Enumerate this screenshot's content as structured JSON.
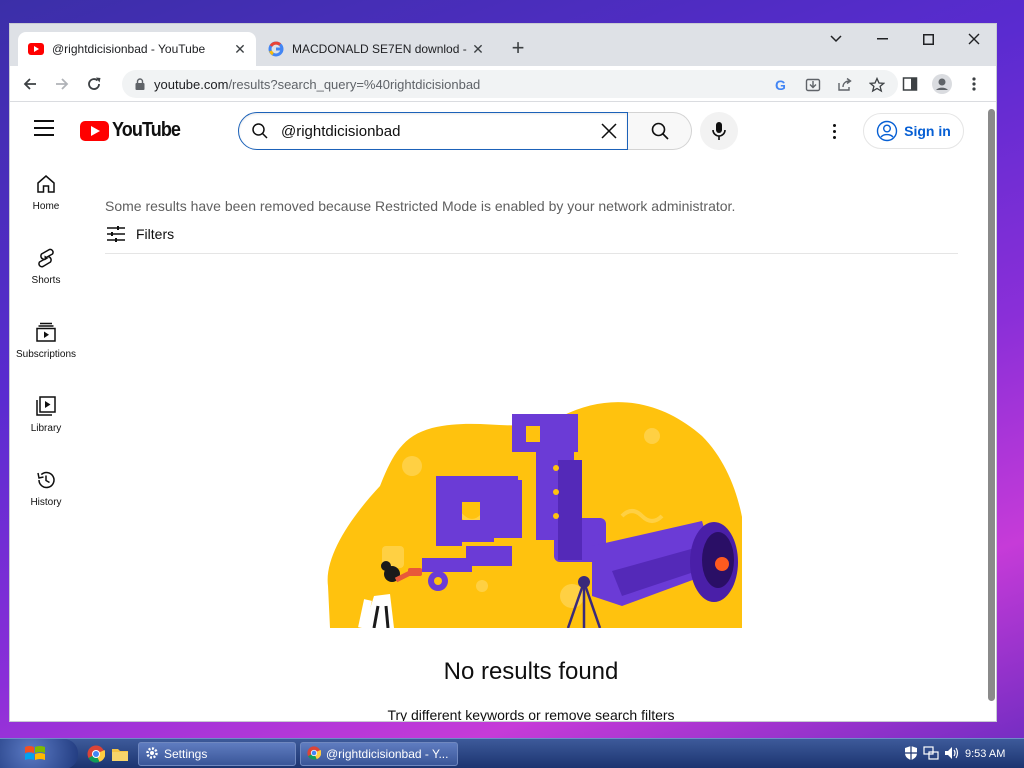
{
  "browser": {
    "tabs": [
      {
        "title": "@rightdicisionbad - YouTube",
        "favicon": "youtube-icon",
        "active": true
      },
      {
        "title": "MACDONALD SE7EN downlod -",
        "favicon": "google-icon",
        "active": false
      }
    ],
    "new_tab_label": "+",
    "url_host": "youtube.com",
    "url_rest": "/results?search_query=%40rightdicisionbad"
  },
  "youtube": {
    "logo_text": "YouTube",
    "search_value": "@rightdicisionbad",
    "sign_in_label": "Sign in",
    "sidebar": [
      {
        "label": "Home",
        "icon": "home-icon"
      },
      {
        "label": "Shorts",
        "icon": "shorts-icon"
      },
      {
        "label": "Subscriptions",
        "icon": "subscriptions-icon"
      },
      {
        "label": "Library",
        "icon": "library-icon"
      },
      {
        "label": "History",
        "icon": "history-icon"
      }
    ],
    "notice": "Some results have been removed because Restricted Mode is enabled by your network administrator.",
    "filters_label": "Filters",
    "no_results_title": "No results found",
    "no_results_hint": "Try different keywords or remove search filters"
  },
  "taskbar": {
    "tasks": [
      {
        "label": "Settings",
        "icon": "gear-icon"
      },
      {
        "label": "@rightdicisionbad - Y...",
        "icon": "chrome-icon"
      }
    ],
    "clock": "9:53 AM"
  },
  "colors": {
    "yt_red": "#ff0000",
    "link_blue": "#065fd4",
    "illustration_yellow": "#ffc20e",
    "illustration_purple": "#6b3bd6"
  }
}
